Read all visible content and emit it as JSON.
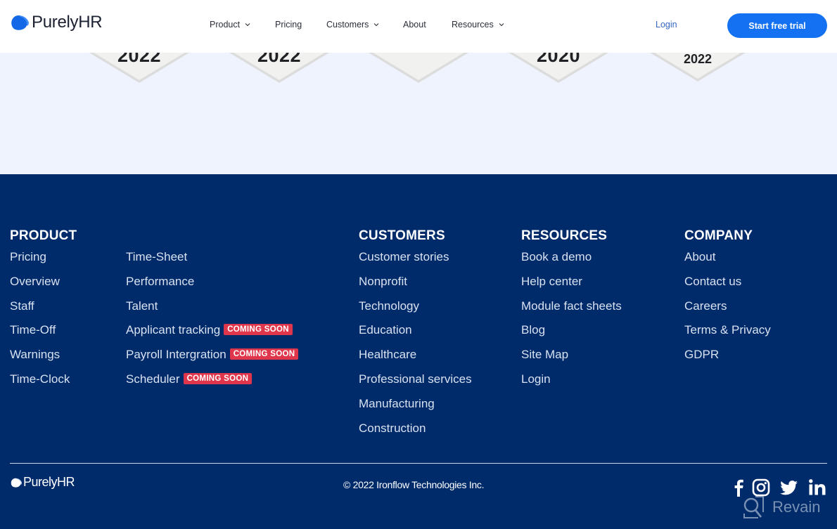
{
  "header": {
    "brand": "PurelyHR",
    "nav": [
      {
        "label": "Product",
        "has_dropdown": true
      },
      {
        "label": "Pricing",
        "has_dropdown": false
      },
      {
        "label": "Customers",
        "has_dropdown": true
      },
      {
        "label": "About",
        "has_dropdown": false
      },
      {
        "label": "Resources",
        "has_dropdown": true
      }
    ],
    "login_label": "Login",
    "cta_label": "Start free trial"
  },
  "badges": [
    {
      "year": "2022"
    },
    {
      "year": "2022"
    },
    {
      "year": ""
    },
    {
      "year": "2020"
    },
    {
      "year": "2022"
    }
  ],
  "footer": {
    "product": {
      "title": "PRODUCT",
      "col1": [
        "Pricing",
        "Overview",
        "Staff",
        "Time-Off",
        "Warnings",
        "Time-Clock"
      ],
      "col2": [
        {
          "label": "Time-Sheet",
          "badge": ""
        },
        {
          "label": "Performance",
          "badge": ""
        },
        {
          "label": "Talent",
          "badge": ""
        },
        {
          "label": "Applicant tracking",
          "badge": "COMING SOON"
        },
        {
          "label": "Payroll Intergration",
          "badge": "COMING SOON"
        },
        {
          "label": "Scheduler",
          "badge": "COMING SOON"
        }
      ]
    },
    "customers": {
      "title": "CUSTOMERS",
      "items": [
        "Customer stories",
        "Nonprofit",
        "Technology",
        "Education",
        "Healthcare",
        "Professional services",
        "Manufacturing",
        "Construction"
      ]
    },
    "resources": {
      "title": "RESOURCES",
      "items": [
        "Book a demo",
        "Help center",
        "Module fact sheets",
        "Blog",
        "Site Map",
        "Login"
      ]
    },
    "company": {
      "title": "COMPANY",
      "items": [
        "About",
        "Contact us",
        "Careers",
        "Terms & Privacy",
        "GDPR"
      ]
    },
    "brand": "PurelyHR",
    "copyright": "© 2022 Ironflow Technologies Inc.",
    "social": [
      "facebook-icon",
      "instagram-icon",
      "twitter-icon",
      "linkedin-icon"
    ],
    "watermark": "Revain"
  },
  "colors": {
    "brand_blue": "#1472f2",
    "footer_bg": "#002b6b",
    "badge_red": "#e0364b",
    "section_bg": "#eef3fd"
  }
}
